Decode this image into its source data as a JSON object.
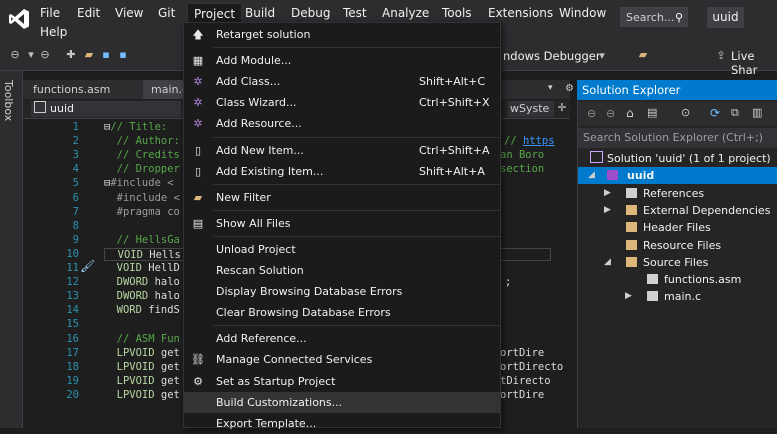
{
  "menubar": {
    "items": [
      "File",
      "Edit",
      "View",
      "Git",
      "Project",
      "Build",
      "Debug",
      "Test",
      "Analyze",
      "Tools",
      "Extensions",
      "Window",
      "Help"
    ],
    "search": "Search...",
    "solution_badge": "uuid"
  },
  "toolbar": {
    "debugger_label": "ndows Debugger",
    "live_share": "Live Shar"
  },
  "toolbox_label": "Toolbox",
  "tabs": [
    "functions.asm",
    "main.c"
  ],
  "navbar": {
    "file": "uuid",
    "right_combo": "wSyste"
  },
  "editor": {
    "lines": [
      {
        "n": "1",
        "parts": [
          [
            "c-plain",
            "⊟"
          ],
          [
            "c-comment",
            "// Title: "
          ]
        ]
      },
      {
        "n": "2",
        "parts": [
          [
            "c-comment",
            "  // Author:"
          ]
        ],
        "tail": [
          [
            "c-comment",
            "// "
          ],
          [
            "c-link",
            "https"
          ]
        ]
      },
      {
        "n": "3",
        "parts": [
          [
            "c-comment",
            "  // Credits"
          ]
        ],
        "tail": [
          [
            "c-comment",
            "an Boro"
          ]
        ]
      },
      {
        "n": "4",
        "parts": [
          [
            "c-comment",
            "  // Dropper"
          ]
        ],
        "tail": [
          [
            "c-comment",
            "section"
          ]
        ]
      },
      {
        "n": "5",
        "parts": [
          [
            "c-plain",
            "⊟"
          ],
          [
            "c-macro",
            "#include <"
          ]
        ]
      },
      {
        "n": "6",
        "parts": [
          [
            "c-macro",
            "  #include <"
          ]
        ]
      },
      {
        "n": "7",
        "parts": [
          [
            "c-macro",
            "  #pragma co"
          ]
        ]
      },
      {
        "n": "8",
        "parts": []
      },
      {
        "n": "9",
        "parts": [
          [
            "c-comment",
            "  // HellsGa"
          ]
        ]
      },
      {
        "n": "10",
        "parts": [
          [
            "c-type",
            "  VOID "
          ],
          [
            "c-plain",
            "Hells"
          ]
        ],
        "box": true
      },
      {
        "n": "11",
        "parts": [
          [
            "c-type",
            "  VOID "
          ],
          [
            "c-plain",
            "HellD"
          ]
        ]
      },
      {
        "n": "12",
        "parts": [
          [
            "c-type",
            "  DWORD "
          ],
          [
            "c-plain",
            "halo"
          ]
        ],
        "tail": [
          [
            "c-plain",
            ";"
          ]
        ]
      },
      {
        "n": "13",
        "parts": [
          [
            "c-type",
            "  DWORD "
          ],
          [
            "c-plain",
            "halo"
          ]
        ]
      },
      {
        "n": "14",
        "parts": [
          [
            "c-type",
            "  WORD "
          ],
          [
            "c-plain",
            "findS"
          ]
        ]
      },
      {
        "n": "15",
        "parts": []
      },
      {
        "n": "16",
        "parts": [
          [
            "c-comment",
            "  // ASM Fun"
          ]
        ]
      },
      {
        "n": "17",
        "parts": [
          [
            "c-type",
            "  LPVOID "
          ],
          [
            "c-plain",
            "get"
          ]
        ],
        "tail": [
          [
            "c-plain",
            "ortDire"
          ]
        ]
      },
      {
        "n": "18",
        "parts": [
          [
            "c-type",
            "  LPVOID "
          ],
          [
            "c-plain",
            "get"
          ]
        ],
        "tail": [
          [
            "c-plain",
            "ortDirecto"
          ]
        ]
      },
      {
        "n": "19",
        "parts": [
          [
            "c-type",
            "  LPVOID "
          ],
          [
            "c-plain",
            "get"
          ]
        ],
        "tail": [
          [
            "c-plain",
            "tDirecto"
          ]
        ]
      },
      {
        "n": "20",
        "parts": [
          [
            "c-type",
            "  LPVOID "
          ],
          [
            "c-plain",
            "get"
          ]
        ],
        "tail": [
          [
            "c-plain",
            "ortDire"
          ]
        ]
      }
    ]
  },
  "solution_explorer": {
    "title": "Solution Explorer",
    "search_placeholder": "Search Solution Explorer (Ctrl+;)",
    "solution_label": "Solution 'uuid' (1 of 1 project)",
    "project": "uuid",
    "nodes": [
      "References",
      "External Dependencies",
      "Header Files",
      "Resource Files",
      "Source Files",
      "functions.asm",
      "main.c"
    ]
  },
  "project_menu": {
    "items": [
      {
        "label": "Retarget solution",
        "shortcut": "",
        "icon": "arrow-up-icon"
      },
      {
        "sep": true
      },
      {
        "label": "Add Module...",
        "shortcut": "",
        "icon": "add-module-icon"
      },
      {
        "label": "Add Class...",
        "shortcut": "Shift+Alt+C",
        "icon": "add-class-icon"
      },
      {
        "label": "Class Wizard...",
        "shortcut": "Ctrl+Shift+X",
        "icon": "class-wizard-icon"
      },
      {
        "label": "Add Resource...",
        "shortcut": "",
        "icon": "add-resource-icon"
      },
      {
        "sep": true
      },
      {
        "label": "Add New Item...",
        "shortcut": "Ctrl+Shift+A",
        "icon": "new-item-icon"
      },
      {
        "label": "Add Existing Item...",
        "shortcut": "Shift+Alt+A",
        "icon": "existing-item-icon"
      },
      {
        "sep": true
      },
      {
        "label": "New Filter",
        "shortcut": "",
        "icon": "new-filter-icon"
      },
      {
        "sep": true
      },
      {
        "label": "Show All Files",
        "shortcut": "",
        "icon": "show-all-files-icon"
      },
      {
        "sep": true
      },
      {
        "label": "Unload Project",
        "shortcut": "",
        "icon": ""
      },
      {
        "label": "Rescan Solution",
        "shortcut": "",
        "icon": ""
      },
      {
        "label": "Display Browsing Database Errors",
        "shortcut": "",
        "icon": ""
      },
      {
        "label": "Clear Browsing Database Errors",
        "shortcut": "",
        "icon": ""
      },
      {
        "sep": true
      },
      {
        "label": "Add Reference...",
        "shortcut": "",
        "icon": ""
      },
      {
        "label": "Manage Connected Services",
        "shortcut": "",
        "icon": "connected-services-icon"
      },
      {
        "label": "Set as Startup Project",
        "shortcut": "",
        "icon": "gear-icon"
      },
      {
        "label": "Build Customizations...",
        "shortcut": "",
        "icon": "",
        "highlight": true
      },
      {
        "label": "Export Template...",
        "shortcut": "",
        "icon": ""
      }
    ]
  }
}
